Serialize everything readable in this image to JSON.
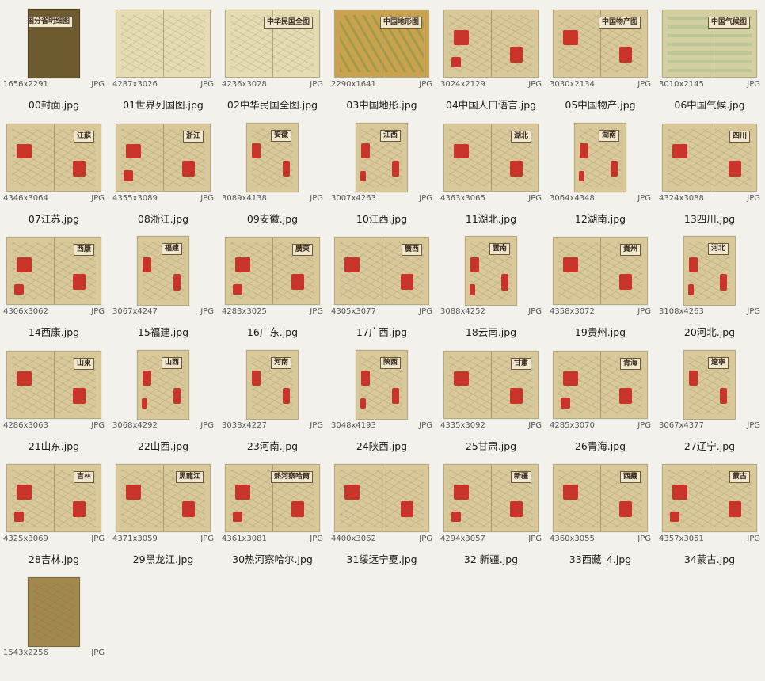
{
  "files": [
    {
      "name": "00封面.jpg",
      "dims": "1656x2291",
      "type": "JPG",
      "orient": "portrait",
      "style": "cover",
      "label": "中国分省明细图"
    },
    {
      "name": "01世界列国图.jpg",
      "dims": "4287x3026",
      "type": "JPG",
      "orient": "landscape",
      "style": "world",
      "label": ""
    },
    {
      "name": "02中华民国全图.jpg",
      "dims": "4236x3028",
      "type": "JPG",
      "orient": "landscape",
      "style": "world",
      "label": "中华民国全图"
    },
    {
      "name": "03中国地形.jpg",
      "dims": "2290x1641",
      "type": "JPG",
      "orient": "landscape",
      "style": "terrain",
      "label": "中国地形图"
    },
    {
      "name": "04中国人口语言.jpg",
      "dims": "3024x2129",
      "type": "JPG",
      "orient": "landscape",
      "style": "map",
      "label": ""
    },
    {
      "name": "05中国物产.jpg",
      "dims": "3030x2134",
      "type": "JPG",
      "orient": "landscape",
      "style": "map",
      "label": "中国物产图"
    },
    {
      "name": "06中国气候.jpg",
      "dims": "3010x2145",
      "type": "JPG",
      "orient": "landscape",
      "style": "green",
      "label": "中国气候图"
    },
    {
      "name": "07江苏.jpg",
      "dims": "4346x3064",
      "type": "JPG",
      "orient": "landscape",
      "style": "province",
      "label": "江蘇"
    },
    {
      "name": "08浙江.jpg",
      "dims": "4355x3089",
      "type": "JPG",
      "orient": "landscape",
      "style": "province",
      "label": "浙江"
    },
    {
      "name": "09安徽.jpg",
      "dims": "3089x4138",
      "type": "JPG",
      "orient": "portrait",
      "style": "province",
      "label": "安徽"
    },
    {
      "name": "10江西.jpg",
      "dims": "3007x4263",
      "type": "JPG",
      "orient": "portrait",
      "style": "province",
      "label": "江西"
    },
    {
      "name": "11湖北.jpg",
      "dims": "4363x3065",
      "type": "JPG",
      "orient": "landscape",
      "style": "province",
      "label": "湖北"
    },
    {
      "name": "12湖南.jpg",
      "dims": "3064x4348",
      "type": "JPG",
      "orient": "portrait",
      "style": "province",
      "label": "湖南"
    },
    {
      "name": "13四川.jpg",
      "dims": "4324x3088",
      "type": "JPG",
      "orient": "landscape",
      "style": "province",
      "label": "四川"
    },
    {
      "name": "14西康.jpg",
      "dims": "4306x3062",
      "type": "JPG",
      "orient": "landscape",
      "style": "province",
      "label": "西康"
    },
    {
      "name": "15福建.jpg",
      "dims": "3067x4247",
      "type": "JPG",
      "orient": "portrait",
      "style": "province",
      "label": "福建"
    },
    {
      "name": "16广东.jpg",
      "dims": "4283x3025",
      "type": "JPG",
      "orient": "landscape",
      "style": "province",
      "label": "廣東"
    },
    {
      "name": "17广西.jpg",
      "dims": "4305x3077",
      "type": "JPG",
      "orient": "landscape",
      "style": "province",
      "label": "廣西"
    },
    {
      "name": "18云南.jpg",
      "dims": "3088x4252",
      "type": "JPG",
      "orient": "portrait",
      "style": "province",
      "label": "雲南"
    },
    {
      "name": "19贵州.jpg",
      "dims": "4358x3072",
      "type": "JPG",
      "orient": "landscape",
      "style": "province",
      "label": "貴州"
    },
    {
      "name": "20河北.jpg",
      "dims": "3108x4263",
      "type": "JPG",
      "orient": "portrait",
      "style": "province",
      "label": "河北"
    },
    {
      "name": "21山东.jpg",
      "dims": "4286x3063",
      "type": "JPG",
      "orient": "landscape",
      "style": "province",
      "label": "山東"
    },
    {
      "name": "22山西.jpg",
      "dims": "3068x4292",
      "type": "JPG",
      "orient": "portrait",
      "style": "province",
      "label": "山西"
    },
    {
      "name": "23河南.jpg",
      "dims": "3038x4227",
      "type": "JPG",
      "orient": "portrait",
      "style": "province",
      "label": "河南"
    },
    {
      "name": "24陕西.jpg",
      "dims": "3048x4193",
      "type": "JPG",
      "orient": "portrait",
      "style": "province",
      "label": "陝西"
    },
    {
      "name": "25甘肃.jpg",
      "dims": "4335x3092",
      "type": "JPG",
      "orient": "landscape",
      "style": "province",
      "label": "甘肅"
    },
    {
      "name": "26青海.jpg",
      "dims": "4285x3070",
      "type": "JPG",
      "orient": "landscape",
      "style": "province",
      "label": "青海"
    },
    {
      "name": "27辽宁.jpg",
      "dims": "3067x4377",
      "type": "JPG",
      "orient": "portrait",
      "style": "province",
      "label": "遼寧"
    },
    {
      "name": "28吉林.jpg",
      "dims": "4325x3069",
      "type": "JPG",
      "orient": "landscape",
      "style": "province",
      "label": "吉林"
    },
    {
      "name": "29黑龙江.jpg",
      "dims": "4371x3059",
      "type": "JPG",
      "orient": "landscape",
      "style": "province",
      "label": "黑龍江"
    },
    {
      "name": "30热河察哈尔.jpg",
      "dims": "4361x3081",
      "type": "JPG",
      "orient": "landscape",
      "style": "province",
      "label": "熱河察哈爾"
    },
    {
      "name": "31绥远宁夏.jpg",
      "dims": "4400x3062",
      "type": "JPG",
      "orient": "landscape",
      "style": "province",
      "label": ""
    },
    {
      "name": "32 新疆.jpg",
      "dims": "4294x3057",
      "type": "JPG",
      "orient": "landscape",
      "style": "province",
      "label": "新疆"
    },
    {
      "name": "33西藏_4.jpg",
      "dims": "4360x3055",
      "type": "JPG",
      "orient": "landscape",
      "style": "province",
      "label": "西藏"
    },
    {
      "name": "34蒙古.jpg",
      "dims": "4357x3051",
      "type": "JPG",
      "orient": "landscape",
      "style": "province",
      "label": "蒙古"
    },
    {
      "name": "",
      "dims": "1543x2256",
      "type": "JPG",
      "orient": "portrait",
      "style": "back",
      "label": ""
    }
  ]
}
